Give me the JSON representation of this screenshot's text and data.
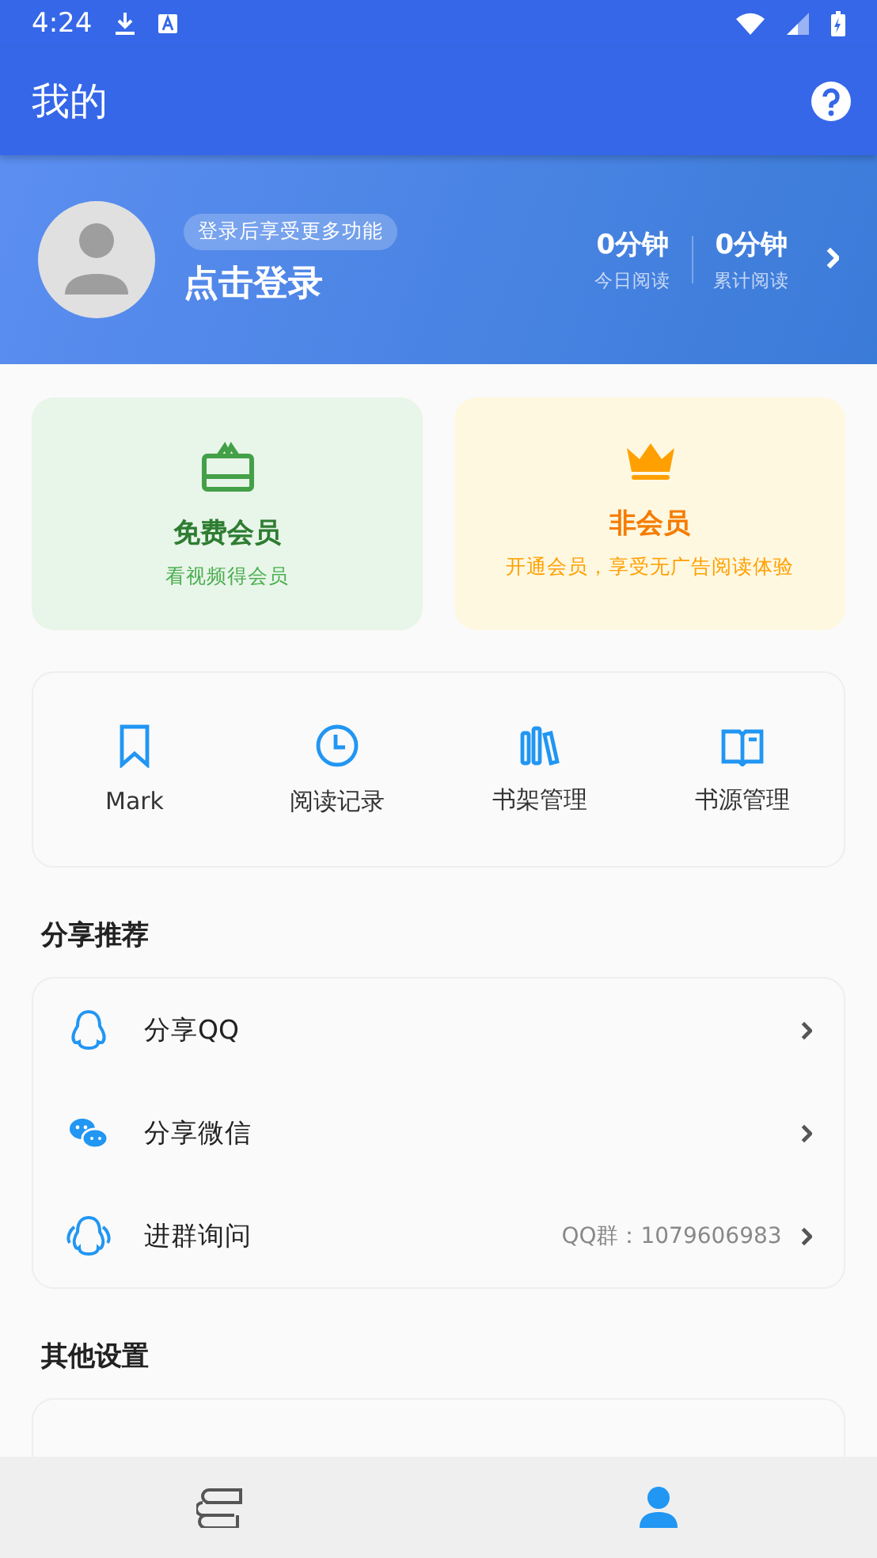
{
  "status_bar": {
    "time": "4:24"
  },
  "toolbar": {
    "title": "我的"
  },
  "profile": {
    "hint": "登录后享受更多功能",
    "login": "点击登录",
    "stats": [
      {
        "value": "0分钟",
        "label": "今日阅读"
      },
      {
        "value": "0分钟",
        "label": "累计阅读"
      }
    ]
  },
  "member_cards": [
    {
      "kind": "free",
      "title": "免费会员",
      "subtitle": "看视频得会员"
    },
    {
      "kind": "vip",
      "title": "非会员",
      "subtitle": "开通会员，享受无广告阅读体验"
    }
  ],
  "shortcuts": [
    {
      "kind": "bookmark",
      "label": "Mark"
    },
    {
      "kind": "clock",
      "label": "阅读记录"
    },
    {
      "kind": "shelf",
      "label": "书架管理"
    },
    {
      "kind": "book",
      "label": "书源管理"
    }
  ],
  "share_section": {
    "title": "分享推荐",
    "items": [
      {
        "kind": "qq",
        "label": "分享QQ"
      },
      {
        "kind": "wechat",
        "label": "分享微信"
      },
      {
        "kind": "group",
        "label": "进群询问",
        "value": "QQ群：1079606983"
      }
    ]
  },
  "settings_section": {
    "title": "其他设置"
  },
  "bottom_nav": [
    {
      "kind": "books",
      "selected": false
    },
    {
      "kind": "person",
      "selected": true
    }
  ]
}
